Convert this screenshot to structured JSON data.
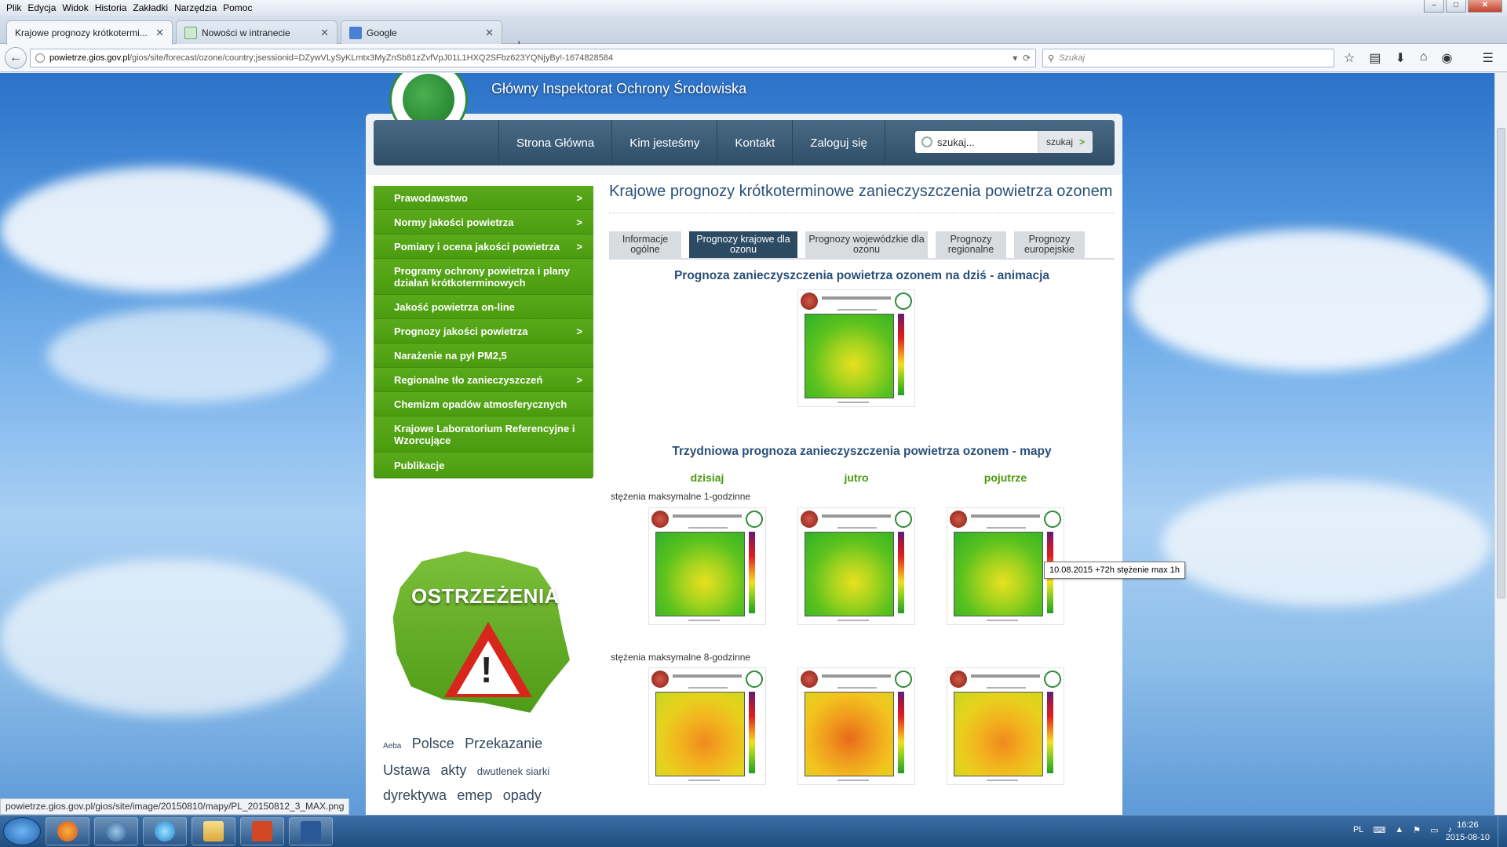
{
  "browser": {
    "menu": [
      "Plik",
      "Edycja",
      "Widok",
      "Historia",
      "Zakładki",
      "Narzędzia",
      "Pomoc"
    ],
    "tabs": [
      {
        "title": "Krajowe prognozy krótkotermi...",
        "active": true
      },
      {
        "title": "Nowości w intranecie",
        "active": false
      },
      {
        "title": "Google",
        "active": false
      }
    ],
    "new_tab": "+",
    "url_host": "powietrze.gios.gov.pl",
    "url_path": "/gios/site/forecast/ozone/country;jsessionid=DZywVLySyKLmtx3MyZnSb81zZvfVpJ01L1HXQ2SFbz623YQNjyBy!-1674828584",
    "search_placeholder": "Szukaj",
    "status_url": "powietrze.gios.gov.pl/gios/site/image/20150810/mapy/PL_20150812_3_MAX.png"
  },
  "site": {
    "title": "Główny Inspektorat Ochrony Środowiska",
    "nav": [
      "Strona Główna",
      "Kim jesteśmy",
      "Kontakt",
      "Zaloguj się"
    ],
    "search_value": "szukaj...",
    "search_button": "szukaj",
    "search_arrow": ">"
  },
  "sidebar": {
    "items": [
      {
        "label": "Prawodawstwo",
        "chevron": ">"
      },
      {
        "label": "Normy jakości powietrza",
        "chevron": ">"
      },
      {
        "label": "Pomiary i ocena jakości powietrza",
        "chevron": ">"
      },
      {
        "label": "Programy ochrony powietrza i plany działań krótkoterminowych",
        "chevron": ""
      },
      {
        "label": "Jakość powietrza on-line",
        "chevron": ""
      },
      {
        "label": "Prognozy jakości powietrza",
        "chevron": ">"
      },
      {
        "label": "Narażenie na pył PM2,5",
        "chevron": ""
      },
      {
        "label": "Regionalne tło zanieczyszczeń",
        "chevron": ">"
      },
      {
        "label": "Chemizm opadów atmosferycznych",
        "chevron": ""
      },
      {
        "label": "Krajowe Laboratorium Referencyjne i Wzorcujące",
        "chevron": ""
      },
      {
        "label": "Publikacje",
        "chevron": ""
      }
    ],
    "warning_title": "OSTRZEŻENIA",
    "tags": [
      "Aeba",
      "Polsce",
      "Przekazanie",
      "Ustawa",
      "akty",
      "dwutlenek siarki",
      "dyrektywa",
      "emep",
      "opady"
    ]
  },
  "main": {
    "title": "Krajowe prognozy krótkoterminowe zanieczyszczenia powietrza ozonem",
    "tabs": [
      {
        "label": "Informacje ogólne",
        "active": false
      },
      {
        "label": "Prognozy krajowe dla ozonu",
        "active": true
      },
      {
        "label": "Prognozy wojewódzkie dla ozonu",
        "active": false
      },
      {
        "label": "Prognozy regionalne",
        "active": false
      },
      {
        "label": "Prognozy europejskie",
        "active": false
      }
    ],
    "animation_title": "Prognoza zanieczyszczenia powietrza ozonem na dziś - animacja",
    "maps_title": "Trzydniowa prognoza zanieczyszczenia powietrza ozonem - mapy",
    "days": [
      "dzisiaj",
      "jutro",
      "pojutrze"
    ],
    "row1_label": "stężenia maksymalne 1-godzinne",
    "row2_label": "stężenia maksymalne 8-godzinne",
    "tooltip": "10.08.2015 +72h stężenie max 1h"
  },
  "taskbar": {
    "lang": "PL",
    "time": "16:26",
    "date": "2015-08-10"
  },
  "colors": {
    "sidebar_green": "#4b9b10",
    "nav_blue": "#2f4d66",
    "active_tab": "#2c4a62",
    "title_blue": "#2a5078"
  }
}
